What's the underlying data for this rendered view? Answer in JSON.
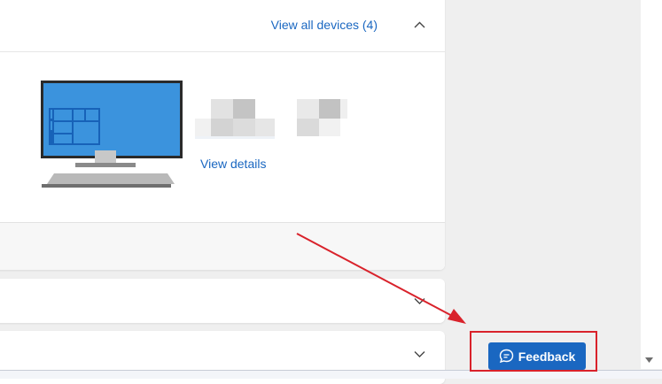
{
  "devices": {
    "view_all_label": "View all devices (4)",
    "view_details_label": "View details"
  },
  "feedback": {
    "label": "Feedback"
  },
  "colors": {
    "link": "#1a67c1",
    "button_bg": "#1a67c1",
    "annotation": "#d9222b",
    "page_bg": "#efefef"
  },
  "icons": {
    "collapse": "chevron-up-icon",
    "expand": "chevron-down-icon",
    "feedback": "speech-bubble-icon",
    "device": "desktop-monitor-icon"
  }
}
